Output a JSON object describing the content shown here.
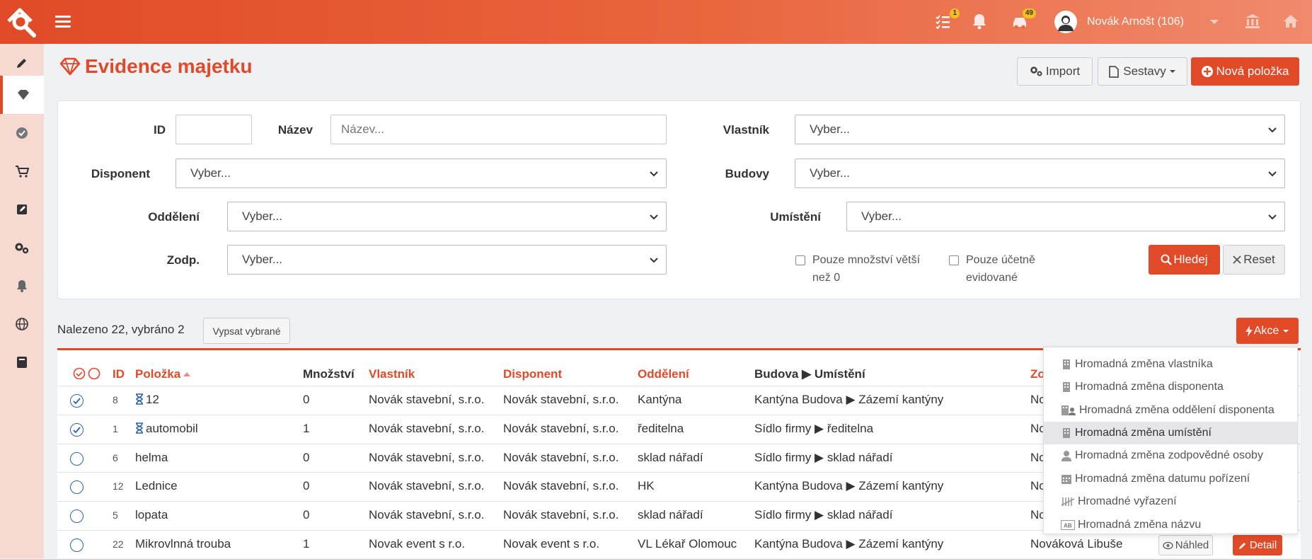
{
  "header": {
    "tasks_badge": "1",
    "notifications_badge": "49",
    "user_name": "Novák Arnošt (106)"
  },
  "page": {
    "title": "Evidence majetku"
  },
  "toolbar": {
    "import_label": "Import",
    "reports_label": "Sestavy",
    "new_item_label": "Nová položka"
  },
  "filters": {
    "id_label": "ID",
    "name_label": "Název",
    "name_placeholder": "Název...",
    "owner_label": "Vlastník",
    "owner_value": "Vyber...",
    "disponent_label": "Disponent",
    "disponent_value": "Vyber...",
    "buildings_label": "Budovy",
    "buildings_value": "Vyber...",
    "department_label": "Oddělení",
    "department_value": "Vyber...",
    "location_label": "Umístění",
    "location_value": "Vyber...",
    "responsible_label": "Zodp.",
    "responsible_value": "Vyber...",
    "qty_checkbox_line1": "Pouze množství větší",
    "qty_checkbox_line2": "než 0",
    "accounting_checkbox_line1": "Pouze účetně",
    "accounting_checkbox_line2": "evidované",
    "search_label": "Hledej",
    "reset_label": "Reset"
  },
  "results": {
    "found_text": "Nalezeno 22, vybráno 2",
    "list_selected_label": "Vypsat vybrané",
    "actions_label": "Akce"
  },
  "table": {
    "columns": {
      "id": "ID",
      "item": "Položka",
      "quantity": "Množství",
      "owner": "Vlastník",
      "disponent": "Disponent",
      "department": "Oddělení",
      "building": "Budova",
      "location": "Umístění",
      "responsible": "Zo"
    },
    "rows": [
      {
        "id": "8",
        "item": "12",
        "quantity": "0",
        "owner": "Novák stavební, s.r.o.",
        "disponent": "Novák stavební, s.r.o.",
        "department": "Kantýna",
        "building": "Kantýna Budova",
        "location": "Zázemí kantýny",
        "responsible": "No",
        "selected": true
      },
      {
        "id": "1",
        "item": "automobil",
        "quantity": "1",
        "owner": "Novák stavební, s.r.o.",
        "disponent": "Novák stavební, s.r.o.",
        "department": "ředitelna",
        "building": "Sídlo firmy",
        "location": "ředitelna",
        "responsible": "No",
        "selected": true
      },
      {
        "id": "6",
        "item": "helma",
        "quantity": "0",
        "owner": "Novák stavební, s.r.o.",
        "disponent": "Novák stavební, s.r.o.",
        "department": "sklad nářadí",
        "building": "Sídlo firmy",
        "location": "sklad nářadí",
        "responsible": "No",
        "selected": false
      },
      {
        "id": "12",
        "item": "Lednice",
        "quantity": "0",
        "owner": "Novák stavební, s.r.o.",
        "disponent": "Novák stavební, s.r.o.",
        "department": "HK",
        "building": "Kantýna Budova",
        "location": "Zázemí kantýny",
        "responsible": "No",
        "selected": false
      },
      {
        "id": "5",
        "item": "lopata",
        "quantity": "0",
        "owner": "Novák stavební, s.r.o.",
        "disponent": "Novák stavební, s.r.o.",
        "department": "sklad nářadí",
        "building": "Sídlo firmy",
        "location": "sklad nářadí",
        "responsible": "No",
        "selected": false
      },
      {
        "id": "22",
        "item": "Mikrovlnná trouba",
        "quantity": "1",
        "owner": "Novak event s r.o.",
        "disponent": "Novak event s r.o.",
        "department": "VL Lékař Olomouc",
        "building": "Kantýna Budova",
        "location": "Zázemí kantýny",
        "responsible": "Nováková Libuše",
        "selected": false
      }
    ],
    "preview_label": "Náhled",
    "detail_label": "Detail"
  },
  "actions_menu": [
    {
      "label": "Hromadná změna vlastníka",
      "icon": "building-icon"
    },
    {
      "label": "Hromadná změna disponenta",
      "icon": "building-icon"
    },
    {
      "label": "Hromadná změna oddělení disponenta",
      "icon": "building-user-icon"
    },
    {
      "label": "Hromadná změna umístění",
      "icon": "building-icon"
    },
    {
      "label": "Hromadná změna zodpovědné osoby",
      "icon": "user-icon"
    },
    {
      "label": "Hromadná změna datumu pořízení",
      "icon": "calendar-icon"
    },
    {
      "label": "Hromadné vyřazení",
      "icon": "strike-icon"
    },
    {
      "label": "Hromadná změna názvu",
      "icon": "ab-icon"
    }
  ],
  "colors": {
    "brand": "#e04a28",
    "sidebar": "#f6d9d1",
    "radio": "#2e62a8"
  }
}
